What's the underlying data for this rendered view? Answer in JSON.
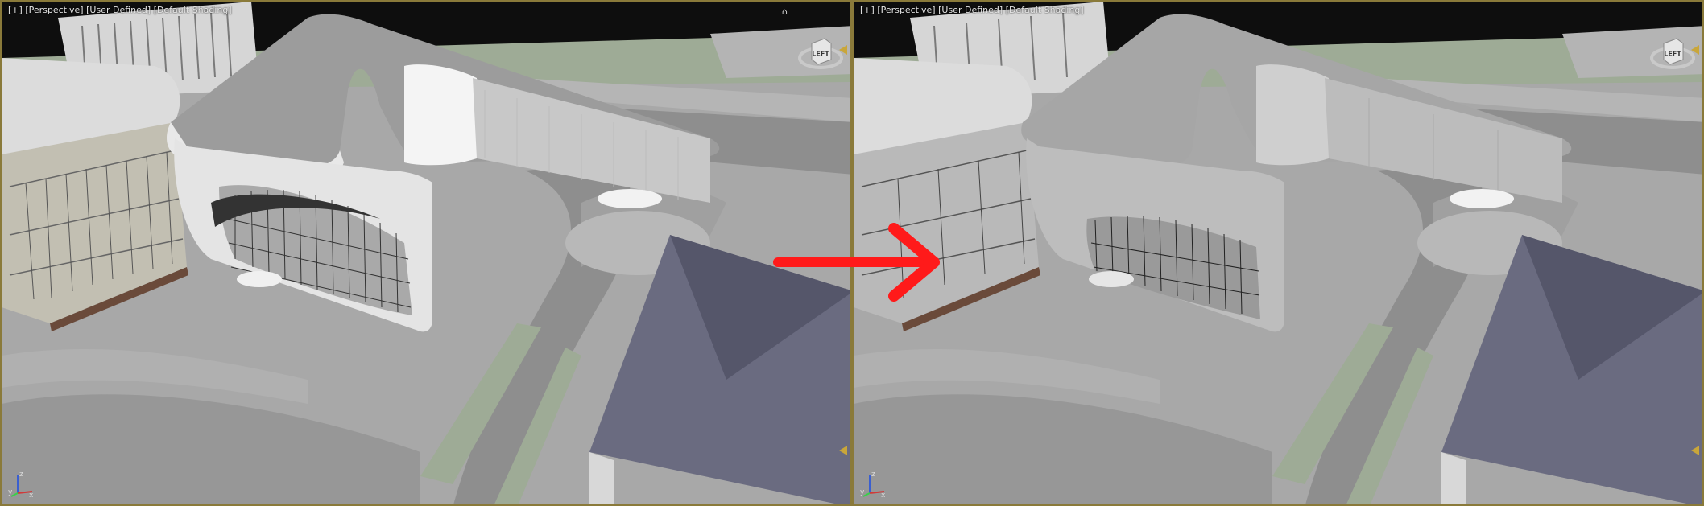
{
  "viewports": [
    {
      "id": "left",
      "label_parts": [
        "[+]",
        "[Perspective]",
        "[User Defined]",
        "[Default Shading]"
      ],
      "viewcube_label": "LEFT",
      "axis_labels": [
        "y",
        "z",
        "x"
      ]
    },
    {
      "id": "right",
      "label_parts": [
        "[+]",
        "[Perspective]",
        "[User Defined]",
        "[Default Shading]"
      ],
      "viewcube_label": "LEFT",
      "axis_labels": [
        "y",
        "z",
        "x"
      ]
    }
  ],
  "icons": {
    "home": "home-icon",
    "viewcube": "viewcube-icon",
    "axis_tripod": "axis-tripod-icon",
    "nav_triangle": "nav-triangle-icon",
    "arrow": "red-arrow-icon"
  },
  "colors": {
    "border": "#8a7a3a",
    "arrow": "#ff1a1a",
    "ground": "#a8a8a8",
    "road": "#8e8e8e",
    "grass": "#9eab96",
    "roof_blue": "#5f6275",
    "building": "#cfcfcf",
    "sky": "#0e0e0e"
  }
}
